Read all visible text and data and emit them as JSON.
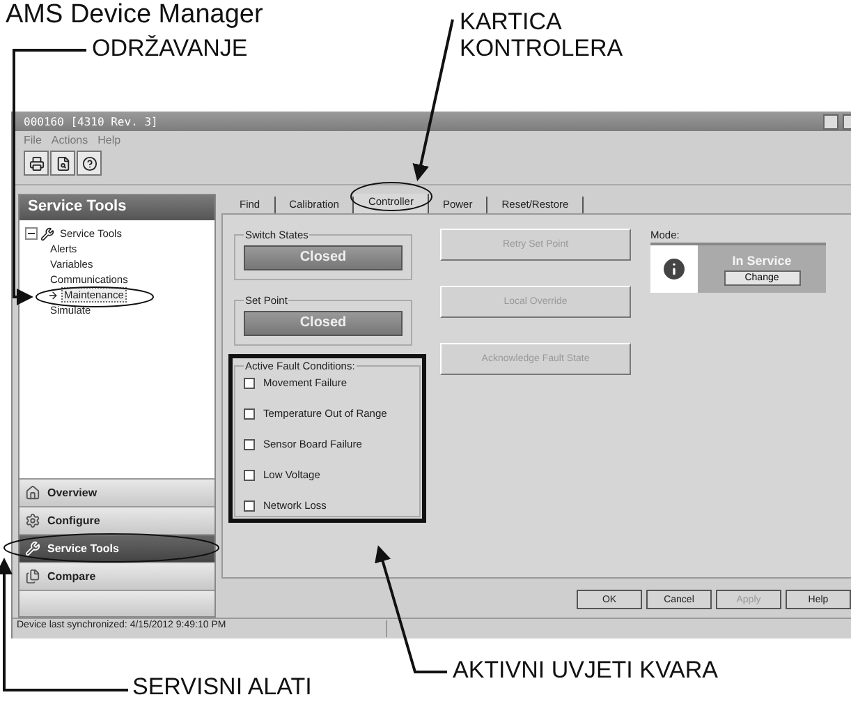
{
  "heading": "AMS Device Manager",
  "callouts": [
    {
      "label": "ODRŽAVANJE"
    },
    {
      "label": "KARTICA KONTROLERA"
    },
    {
      "label": "SERVISNI ALATI"
    },
    {
      "label": "AKTIVNI UVJETI KVARA"
    }
  ],
  "window": {
    "title": "000160 [4310 Rev. 3]",
    "menu": [
      "File",
      "Actions",
      "Help"
    ]
  },
  "sidebar": {
    "title": "Service Tools",
    "tree": {
      "label": "Service Tools",
      "expanded": true,
      "children": [
        {
          "label": "Alerts",
          "selected": false
        },
        {
          "label": "Variables",
          "selected": false
        },
        {
          "label": "Communications",
          "selected": false
        },
        {
          "label": "Maintenance",
          "selected": true
        },
        {
          "label": "Simulate",
          "selected": false
        }
      ]
    },
    "nav": [
      {
        "label": "Overview",
        "kind": "home",
        "selected": false
      },
      {
        "label": "Configure",
        "kind": "gear",
        "selected": false
      },
      {
        "label": "Service Tools",
        "kind": "tools",
        "selected": true
      },
      {
        "label": "Compare",
        "kind": "pages",
        "selected": false
      }
    ]
  },
  "tabs": [
    {
      "label": "Find",
      "selected": false
    },
    {
      "label": "Calibration",
      "selected": false
    },
    {
      "label": "Controller",
      "selected": true
    },
    {
      "label": "Power",
      "selected": false
    },
    {
      "label": "Reset/Restore",
      "selected": false
    }
  ],
  "switch_states": {
    "title": "Switch States",
    "value": "Closed"
  },
  "set_point": {
    "title": "Set Point",
    "value": "Closed"
  },
  "fault_conditions": {
    "title": "Active Fault Conditions:",
    "items": [
      {
        "label": "Movement Failure",
        "checked": false
      },
      {
        "label": "Temperature Out of Range",
        "checked": false
      },
      {
        "label": "Sensor Board Failure",
        "checked": false
      },
      {
        "label": "Low Voltage",
        "checked": false
      },
      {
        "label": "Network Loss",
        "checked": false
      }
    ]
  },
  "actions": [
    {
      "label": "Retry Set Point",
      "disabled": true
    },
    {
      "label": "Local Override",
      "disabled": true
    },
    {
      "label": "Acknowledge Fault State",
      "disabled": true
    }
  ],
  "mode": {
    "title": "Mode:",
    "value": "In Service",
    "button": "Change"
  },
  "buttons": [
    {
      "label": "OK",
      "disabled": false
    },
    {
      "label": "Cancel",
      "disabled": false
    },
    {
      "label": "Apply",
      "disabled": true
    },
    {
      "label": "Help",
      "disabled": false
    }
  ],
  "status_bar": "Device last synchronized: 4/15/2012 9:49:10 PM"
}
